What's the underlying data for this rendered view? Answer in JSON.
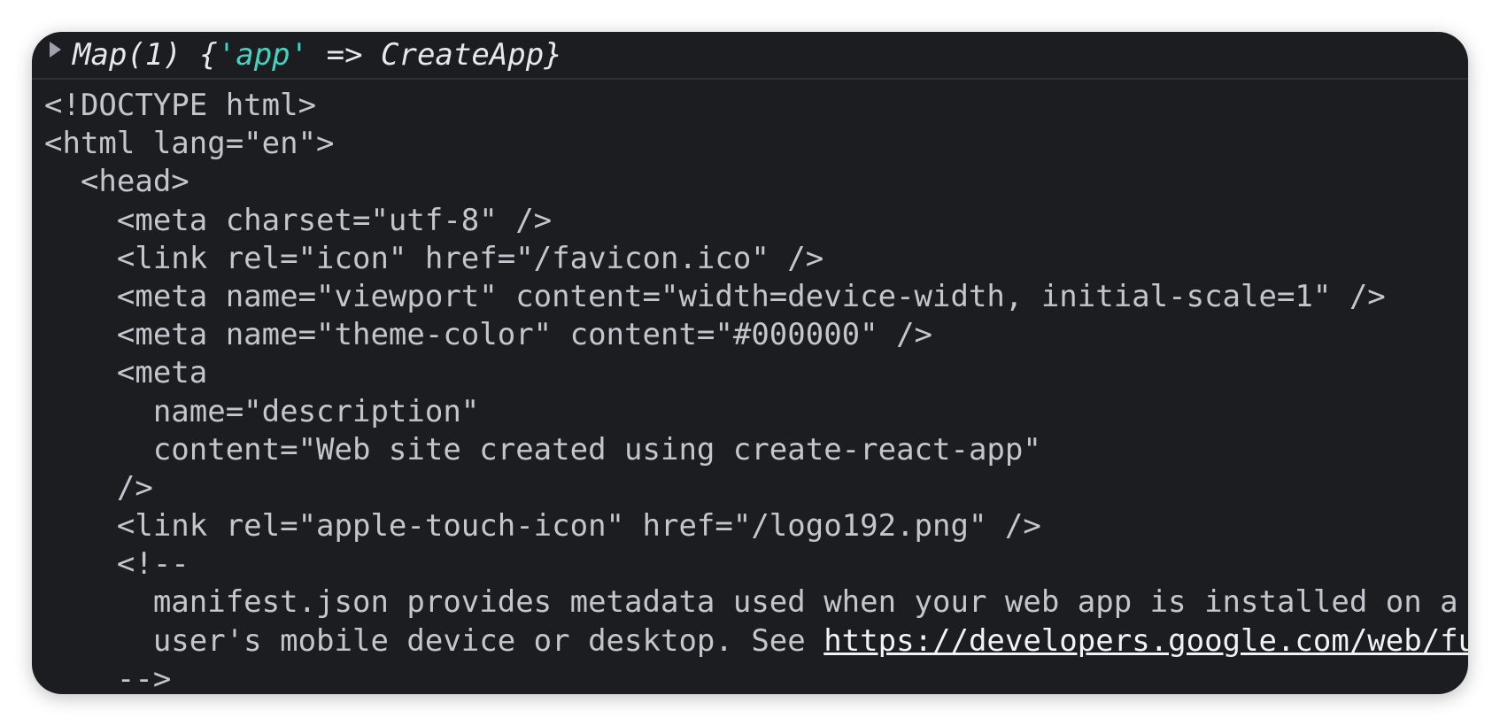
{
  "map_entry": {
    "prefix": "Map(1) {",
    "key": "'app'",
    "arrow": " => ",
    "value": "CreateApp",
    "suffix": "}"
  },
  "code_lines": [
    "<!DOCTYPE html>",
    "<html lang=\"en\">",
    "  <head>",
    "    <meta charset=\"utf-8\" />",
    "    <link rel=\"icon\" href=\"/favicon.ico\" />",
    "    <meta name=\"viewport\" content=\"width=device-width, initial-scale=1\" />",
    "    <meta name=\"theme-color\" content=\"#000000\" />",
    "    <meta",
    "      name=\"description\"",
    "      content=\"Web site created using create-react-app\"",
    "    />",
    "    <link rel=\"apple-touch-icon\" href=\"/logo192.png\" />",
    "    <!--",
    "      manifest.json provides metadata used when your web app is installed on a",
    "      user's mobile device or desktop. See ",
    "    -->"
  ],
  "link": {
    "text": "https://developers.google.com/web/fundamentals/web-app-manifest/"
  },
  "colors": {
    "panel_background": "#1c1d20",
    "code_text": "#c3c6cc",
    "map_key": "#45d2c0"
  }
}
